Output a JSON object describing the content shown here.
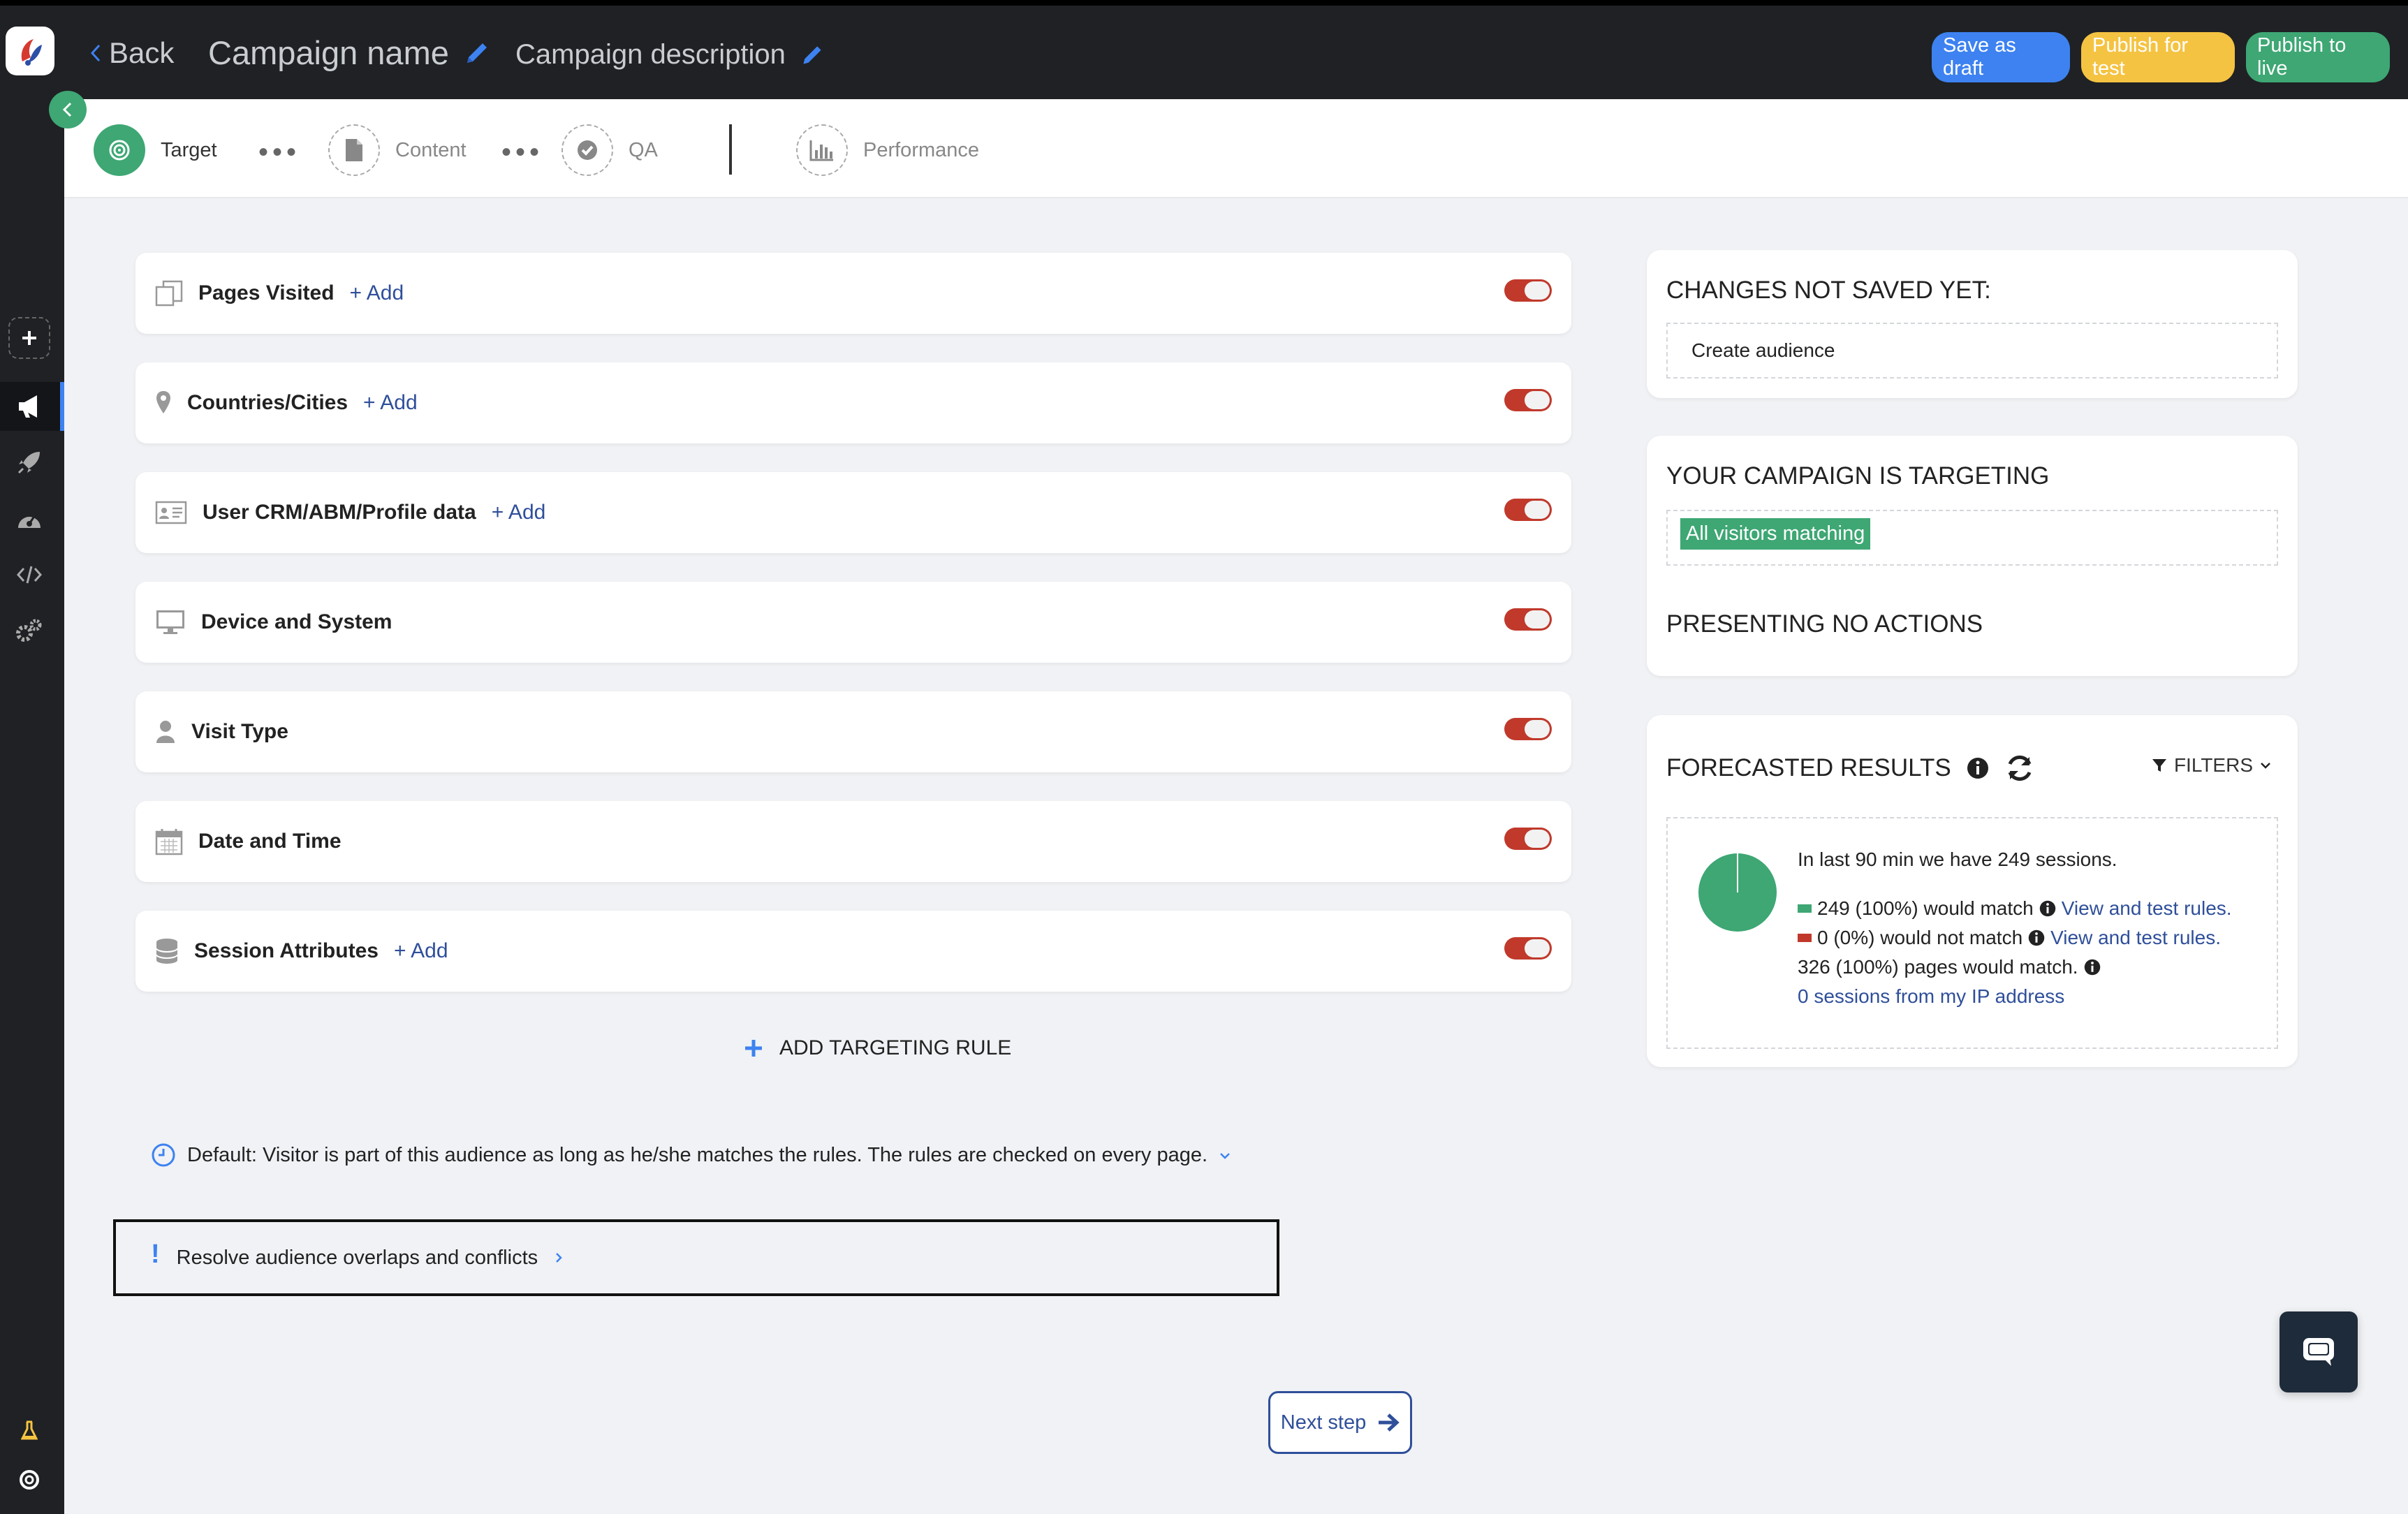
{
  "header": {
    "back_label": "Back",
    "campaign_name": "Campaign name",
    "campaign_description": "Campaign description",
    "save_draft": "Save as draft",
    "publish_test": "Publish for test",
    "publish_live": "Publish to live"
  },
  "steps": [
    {
      "label": "Target",
      "active": true
    },
    {
      "label": "Content"
    },
    {
      "label": "QA"
    },
    {
      "label": "Performance"
    }
  ],
  "rules": [
    {
      "label": "Pages Visited",
      "add": "+ Add",
      "icon": "pages-icon"
    },
    {
      "label": "Countries/Cities",
      "add": "+ Add",
      "icon": "map-pin-icon"
    },
    {
      "label": "User CRM/ABM/Profile data",
      "add": "+ Add",
      "icon": "id-card-icon"
    },
    {
      "label": "Device and System",
      "icon": "monitor-icon"
    },
    {
      "label": "Visit Type",
      "icon": "user-icon"
    },
    {
      "label": "Date and Time",
      "icon": "calendar-icon"
    },
    {
      "label": "Session Attributes",
      "add": "+ Add",
      "icon": "database-icon"
    }
  ],
  "add_targeting_rule": "ADD TARGETING RULE",
  "default_note": "Default: Visitor is part of this audience as long as he/she matches the rules. The rules are checked on every page.",
  "resolve_label": "Resolve audience overlaps and conflicts",
  "next_step": "Next step",
  "changes_panel": {
    "title": "CHANGES NOT SAVED YET:",
    "item": "Create audience"
  },
  "targeting_panel": {
    "title": "YOUR CAMPAIGN IS TARGETING",
    "tag": "All visitors matching",
    "actions": "PRESENTING NO ACTIONS"
  },
  "forecast_panel": {
    "title": "FORECASTED RESULTS",
    "filters": "FILTERS",
    "summary": "In last 90 min we have 249 sessions.",
    "match": "249 (100%) would match",
    "no_match": "0 (0%) would not match",
    "view_rules": "View and test rules.",
    "pages": "326 (100%) pages would match.",
    "ip_link": "0 sessions from my IP address",
    "match_fraction": 1.0,
    "match_color": "#3ea774",
    "no_match_color": "#c0392b"
  }
}
